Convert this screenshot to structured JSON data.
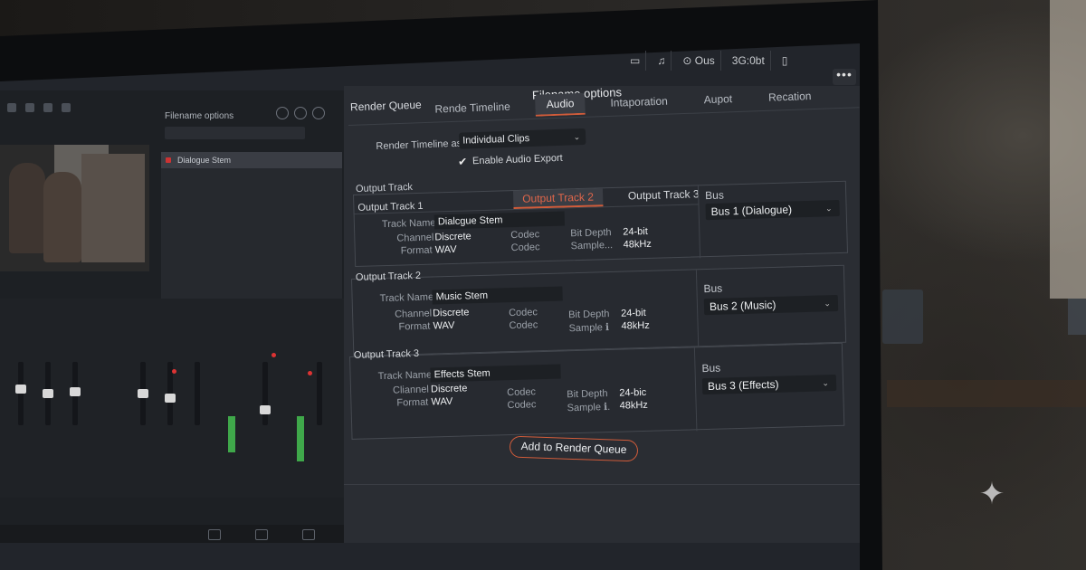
{
  "toolbar": {
    "output_label": "Ous",
    "code_label": "3G:0bt",
    "more_label": "•••"
  },
  "left_panel": {
    "filename_options_title": "Filename options",
    "list_item": "Dialogue Stem"
  },
  "main": {
    "render_queue_title": "Render Queue",
    "panel_title": "Filename options",
    "tabs": [
      {
        "label": "Rende Timeline"
      },
      {
        "label": "Audio"
      },
      {
        "label": "Intaporation"
      },
      {
        "label": "Aupot"
      },
      {
        "label": "Recation"
      }
    ],
    "active_tab_index": 1,
    "render_timeline_label": "Render Timeline as",
    "render_timeline_value": "Individual Clips",
    "enable_audio_label": "Enable Audio Export",
    "enable_audio_checked": true,
    "output_track_heading": "Output Track",
    "add_button_label": "Add to Render Queue"
  },
  "tracks": [
    {
      "label": "Output Track 1",
      "subtabs": [
        "Output Track 2",
        "Output Track 3"
      ],
      "track_name_label": "Track Name",
      "track_name": "Dialcgue Stem",
      "channel_label": "Channel",
      "channel": "Discrete",
      "format_label": "Format",
      "format": "WAV",
      "codec_label_1": "Codec",
      "codec_label_2": "Codec",
      "bit_depth_label": "Bit Depth",
      "bit_depth": "24-bit",
      "sample_label": "Sample...",
      "sample": "48kHz",
      "bus_label": "Bus",
      "bus": "Bus 1 (Dialogue)"
    },
    {
      "label": "Output Track 2",
      "track_name_label": "Track Name",
      "track_name": "Music Stem",
      "channel_label": "Channel",
      "channel": "Discrete",
      "format_label": "Format",
      "format": "WAV",
      "codec_label_1": "Codec",
      "codec_label_2": "Codec",
      "bit_depth_label": "Bit Depth",
      "bit_depth": "24-bit",
      "sample_label": "Sample ℹ",
      "sample": "48kHz",
      "bus_label": "Bus",
      "bus": "Bus 2 (Music)"
    },
    {
      "label": "Output Track 3",
      "track_name_label": "Track Name",
      "track_name": "Effects Stem",
      "channel_label": "Cliannel",
      "channel": "Discrete",
      "format_label": "Format",
      "format": "WAV",
      "codec_label_1": "Codec",
      "codec_label_2": "Codec",
      "bit_depth_label": "Bit Depth",
      "bit_depth": "24-bic",
      "sample_label": "Sample ℹ.",
      "sample": "48kHz",
      "bus_label": "Bus",
      "bus": "Bus 3 (Effects)"
    }
  ],
  "colors": {
    "accent": "#d25c3a",
    "panel_bg": "#2a2d33",
    "meter_green": "#3fa84a"
  }
}
